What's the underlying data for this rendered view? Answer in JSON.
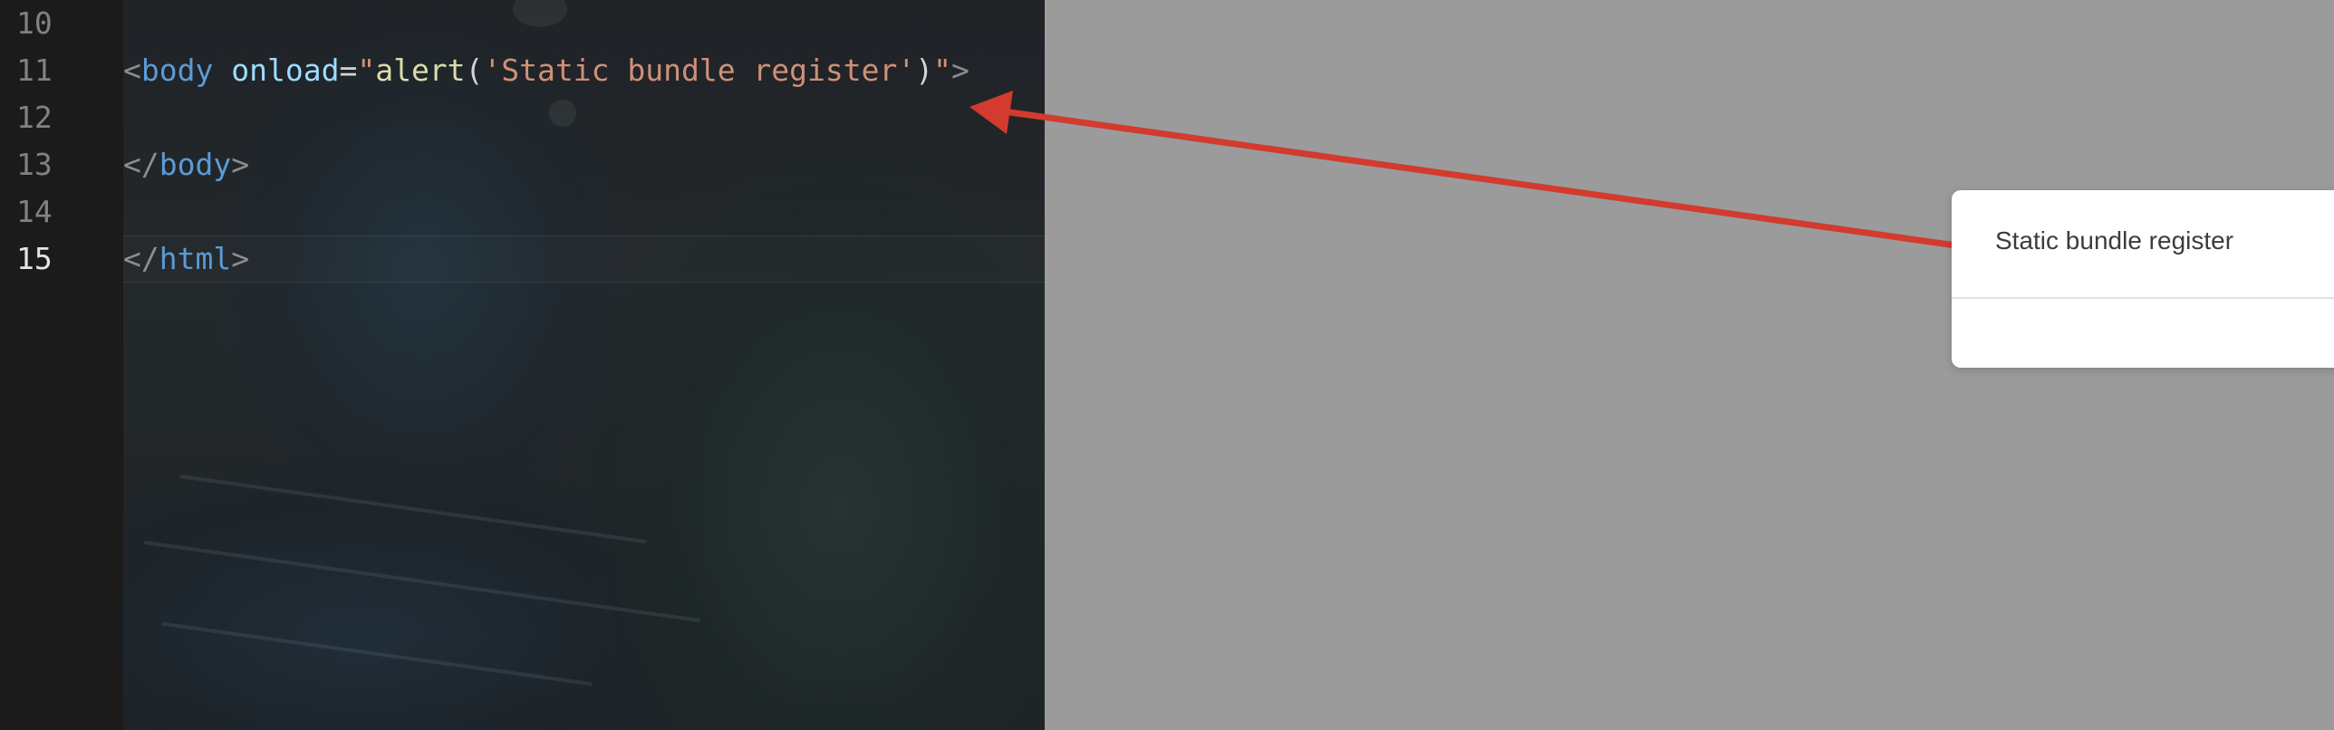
{
  "editor": {
    "line_numbers": [
      "10",
      "11",
      "12",
      "13",
      "14",
      "15"
    ],
    "current_line": "15",
    "lines": {
      "line11": {
        "open_bracket": "<",
        "tag": "body",
        "space": " ",
        "attr": "onload",
        "eq": "=",
        "quote_open": "\"",
        "fn": "alert",
        "paren_open": "(",
        "string": "'Static bundle register'",
        "paren_close": ")",
        "quote_close": "\"",
        "close_bracket": ">"
      },
      "line13": {
        "open_bracket": "</",
        "tag": "body",
        "close_bracket": ">"
      },
      "line15": {
        "open_bracket": "</",
        "tag": "html",
        "close_bracket": ">"
      }
    }
  },
  "dialog": {
    "message": "Static bundle register"
  },
  "colors": {
    "annotation_arrow": "#d23b2d",
    "overlay_background": "#9b9b9b",
    "tag": "#5a9bd5",
    "attribute": "#9cdcfe",
    "string": "#ce9178",
    "function": "#dcdcaa"
  }
}
